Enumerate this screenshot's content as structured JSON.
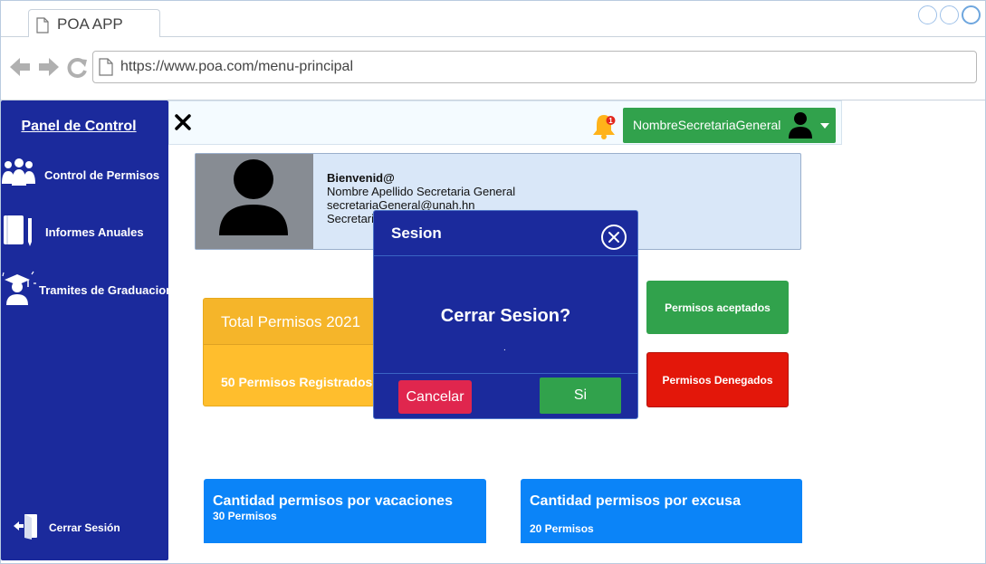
{
  "browser": {
    "tab_title": "POA APP",
    "url": "https://www.poa.com/menu-principal"
  },
  "sidebar": {
    "title": "Panel de Control",
    "items": [
      {
        "label": "Control de Permisos",
        "icon": "users-icon"
      },
      {
        "label": "Informes Anuales",
        "icon": "notebook-icon"
      },
      {
        "label": "Tramites de Graduacion",
        "icon": "graduate-icon"
      }
    ],
    "logout_label": "Cerrar Sesión"
  },
  "topbar": {
    "notification_count": "1",
    "user_name": "NombreSecretariaGeneral"
  },
  "welcome": {
    "greeting": "Bienvenid@",
    "name": "Nombre Apellido Secretaria General",
    "email": "secretariaGeneral@unah.hn",
    "role": "Secretaria General"
  },
  "total_card": {
    "title": "Total Permisos 2021",
    "subtitle": "50 Permisos Registrados"
  },
  "buttons": {
    "accepted": "Permisos aceptados",
    "denied": "Permisos Denegados"
  },
  "stats": [
    {
      "title": "Cantidad permisos por vacaciones",
      "value": "30 Permisos"
    },
    {
      "title": "Cantidad permisos por excusa",
      "value": "20 Permisos"
    }
  ],
  "modal": {
    "title": "Sesion",
    "question": "Cerrar Sesion?",
    "dot": ".",
    "cancel_label": "Cancelar",
    "confirm_label": "Si"
  },
  "colors": {
    "sidebar_bg": "#1b2a9c",
    "green": "#31a24c",
    "red": "#e3170a",
    "yellow": "#ffbe2d",
    "blue": "#0b84f8",
    "cancel": "#e0264e"
  }
}
